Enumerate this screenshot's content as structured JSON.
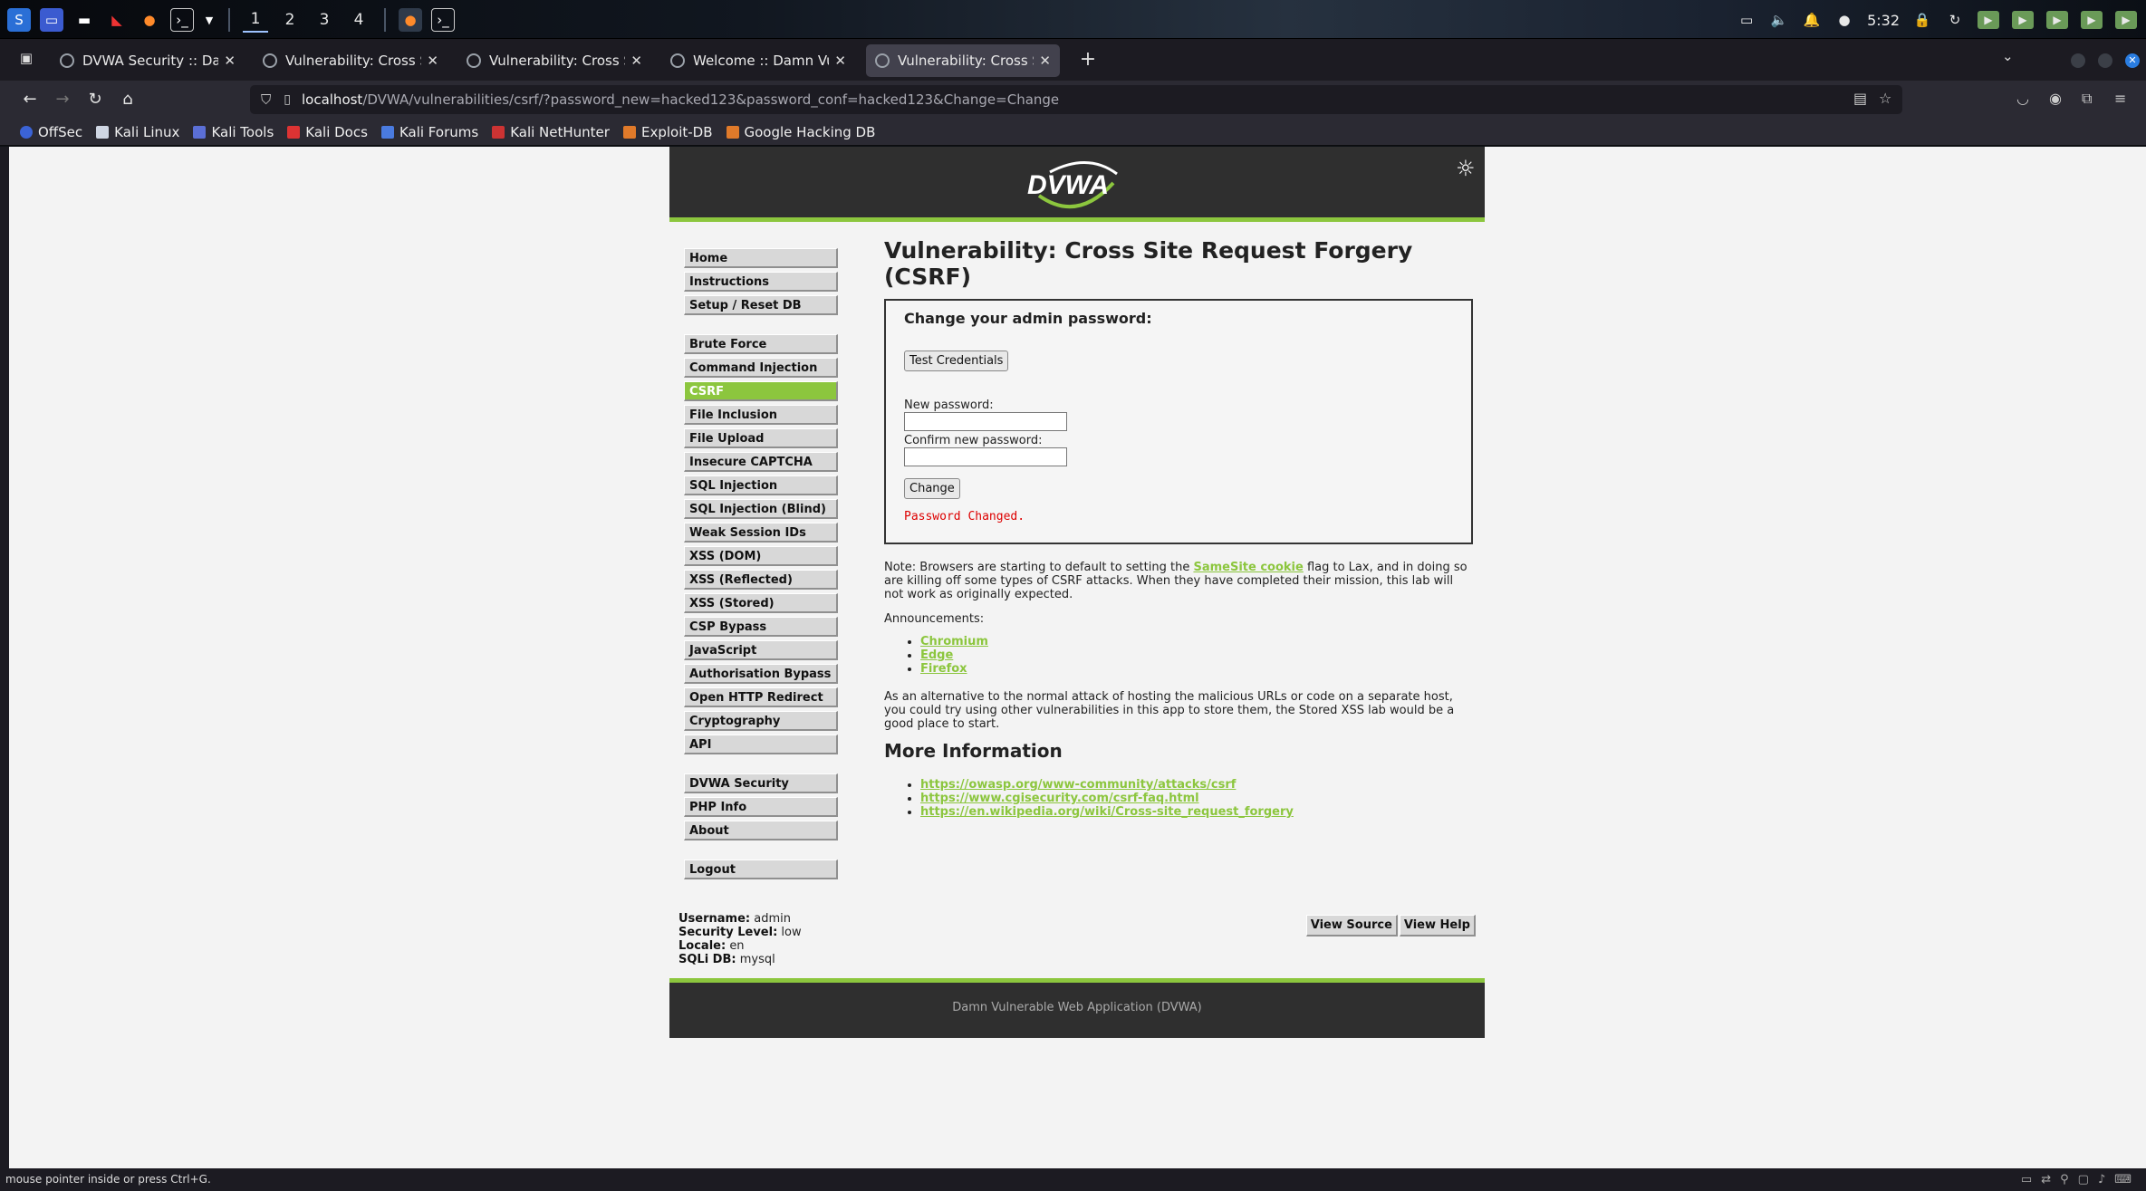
{
  "taskbar": {
    "workspaces": [
      "1",
      "2",
      "3",
      "4"
    ],
    "clock": "5:32",
    "icons": [
      "kali-menu-icon",
      "desktop-icon",
      "file-manager-icon",
      "text-editor-icon",
      "firefox-icon",
      "terminal-icon"
    ]
  },
  "browser": {
    "tabs": [
      {
        "title": "DVWA Security :: Damn V",
        "active": false
      },
      {
        "title": "Vulnerability: Cross Site R",
        "active": false
      },
      {
        "title": "Vulnerability: Cross Site R",
        "active": false
      },
      {
        "title": "Welcome :: Damn Vulner",
        "active": false
      },
      {
        "title": "Vulnerability: Cross Site R",
        "active": true
      }
    ],
    "url_host": "localhost",
    "url_path": "/DVWA/vulnerabilities/csrf/?password_new=hacked123&password_conf=hacked123&Change=Change",
    "bookmarks": [
      "OffSec",
      "Kali Linux",
      "Kali Tools",
      "Kali Docs",
      "Kali Forums",
      "Kali NetHunter",
      "Exploit-DB",
      "Google Hacking DB"
    ]
  },
  "dvwa": {
    "logo_text": "DVWA",
    "menu_group1": [
      "Home",
      "Instructions",
      "Setup / Reset DB"
    ],
    "menu_group2": [
      "Brute Force",
      "Command Injection",
      "CSRF",
      "File Inclusion",
      "File Upload",
      "Insecure CAPTCHA",
      "SQL Injection",
      "SQL Injection (Blind)",
      "Weak Session IDs",
      "XSS (DOM)",
      "XSS (Reflected)",
      "XSS (Stored)",
      "CSP Bypass",
      "JavaScript",
      "Authorisation Bypass",
      "Open HTTP Redirect",
      "Cryptography",
      "API"
    ],
    "menu_group3": [
      "DVWA Security",
      "PHP Info",
      "About"
    ],
    "menu_group4": [
      "Logout"
    ],
    "active_menu": "CSRF",
    "page_title": "Vulnerability: Cross Site Request Forgery (CSRF)",
    "form": {
      "heading": "Change your admin password:",
      "test_button": "Test Credentials",
      "new_password_label": "New password:",
      "confirm_password_label": "Confirm new password:",
      "new_password_value": "",
      "confirm_password_value": "",
      "change_button": "Change",
      "message": "Password Changed."
    },
    "note_prefix": "Note: Browsers are starting to default to setting the ",
    "note_link": "SameSite cookie",
    "note_suffix": " flag to Lax, and in doing so are killing off some types of CSRF attacks. When they have completed their mission, this lab will not work as originally expected.",
    "announcements_label": "Announcements:",
    "announcements": [
      "Chromium",
      "Edge",
      "Firefox"
    ],
    "alternative_text": "As an alternative to the normal attack of hosting the malicious URLs or code on a separate host, you could try using other vulnerabilities in this app to store them, the Stored XSS lab would be a good place to start.",
    "more_info_title": "More Information",
    "more_info_links": [
      "https://owasp.org/www-community/attacks/csrf",
      "https://www.cgisecurity.com/csrf-faq.html",
      "https://en.wikipedia.org/wiki/Cross-site_request_forgery"
    ],
    "userinfo": {
      "username_label": "Username:",
      "username": "admin",
      "security_label": "Security Level:",
      "security": "low",
      "locale_label": "Locale:",
      "locale": "en",
      "sqli_label": "SQLi DB:",
      "sqli": "mysql"
    },
    "view_source": "View Source",
    "view_help": "View Help",
    "footer": "Damn Vulnerable Web Application (DVWA)"
  },
  "statusbar": {
    "text": "mouse pointer inside or press Ctrl+G."
  }
}
